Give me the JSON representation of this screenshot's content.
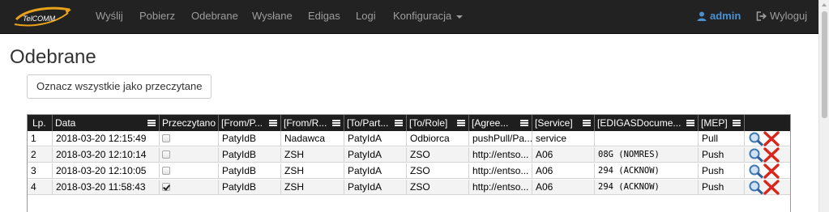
{
  "nav": {
    "brand": "TelCOMM",
    "items": [
      {
        "label": "Wyślij"
      },
      {
        "label": "Pobierz"
      },
      {
        "label": "Odebrane"
      },
      {
        "label": "Wysłane"
      },
      {
        "label": "Edigas"
      },
      {
        "label": "Logi"
      },
      {
        "label": "Konfiguracja"
      }
    ],
    "user": "admin",
    "logout": "Wyloguj"
  },
  "page": {
    "title": "Odebrane",
    "mark_all_button": "Oznacz wszystkie jako przeczytane"
  },
  "grid": {
    "columns": [
      "Lp.",
      "Data",
      "Przeczytano",
      "[From/P...",
      "[From/R...",
      "[To/Part...",
      "[To/Role]",
      "[Agree...",
      "[Service]",
      "[EDIGASDocume...",
      "[MEP]"
    ],
    "rows": [
      {
        "lp": "1",
        "data": "2018-03-20 12:15:49",
        "read": false,
        "from_party": "PatyIdB",
        "from_role": "Nadawca",
        "to_party": "PatyIdA",
        "to_role": "Odbiorca",
        "agreement": "pushPull/Pa...",
        "service": "service",
        "edigas_doc": "",
        "mep": "Pull"
      },
      {
        "lp": "2",
        "data": "2018-03-20 12:10:14",
        "read": false,
        "from_party": "PatyIdB",
        "from_role": "ZSH",
        "to_party": "PatyIdA",
        "to_role": "ZSO",
        "agreement": "http://entso...",
        "service": "A06",
        "edigas_doc": "08G (NOMRES)",
        "mep": "Push"
      },
      {
        "lp": "3",
        "data": "2018-03-20 12:10:05",
        "read": false,
        "from_party": "PatyIdB",
        "from_role": "ZSH",
        "to_party": "PatyIdA",
        "to_role": "ZSO",
        "agreement": "http://entso...",
        "service": "A06",
        "edigas_doc": "294 (ACKNOW)",
        "mep": "Push"
      },
      {
        "lp": "4",
        "data": "2018-03-20 11:58:43",
        "read": true,
        "from_party": "PatyIdB",
        "from_role": "ZSH",
        "to_party": "PatyIdA",
        "to_role": "ZSO",
        "agreement": "http://entso...",
        "service": "A06",
        "edigas_doc": "294 (ACKNOW)",
        "mep": "Push"
      }
    ]
  },
  "colors": {
    "navbar": "#222222",
    "grid_header": "#1e1e1e",
    "accent": "#4a90d0",
    "delete": "#d9261c"
  }
}
